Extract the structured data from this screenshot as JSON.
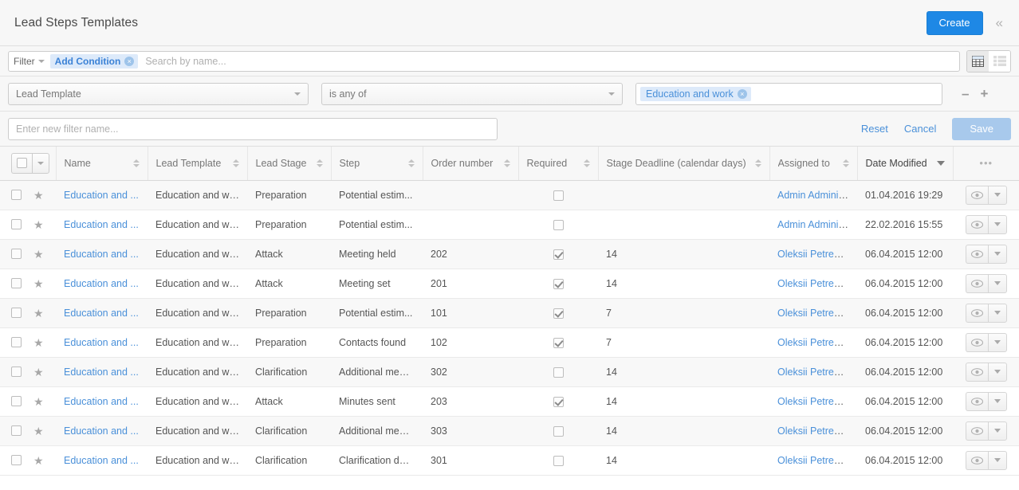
{
  "header": {
    "title": "Lead Steps Templates",
    "create_label": "Create",
    "collapse_icon": "chevron-double-left-icon"
  },
  "searchbar": {
    "filter_label": "Filter",
    "condition_chip": "Add Condition",
    "chip_remove": "×",
    "search_placeholder": "Search by name...",
    "search_value": "",
    "view_table_icon": "grid-view-icon",
    "view_list_icon": "list-view-icon",
    "active_view": "table"
  },
  "condition": {
    "field": "Lead Template",
    "operator": "is any of",
    "value_tag": "Education and work",
    "tag_remove": "×",
    "remove_condition_icon": "minus-icon",
    "add_condition_icon": "plus-icon"
  },
  "save_filter": {
    "name_placeholder": "Enter new filter name...",
    "name_value": "",
    "reset_label": "Reset",
    "cancel_label": "Cancel",
    "save_label": "Save"
  },
  "table": {
    "columns": [
      {
        "key": "name",
        "label": "Name",
        "sortable": true
      },
      {
        "key": "lead_template",
        "label": "Lead Template",
        "sortable": true
      },
      {
        "key": "lead_stage",
        "label": "Lead Stage",
        "sortable": true
      },
      {
        "key": "step",
        "label": "Step",
        "sortable": true
      },
      {
        "key": "order_number",
        "label": "Order number",
        "sortable": true
      },
      {
        "key": "required",
        "label": "Required",
        "sortable": true
      },
      {
        "key": "stage_deadline",
        "label": "Stage Deadline (calendar days)",
        "sortable": true
      },
      {
        "key": "assigned_to",
        "label": "Assigned to",
        "sortable": true
      },
      {
        "key": "date_modified",
        "label": "Date Modified",
        "sortable": true,
        "sorted": "desc"
      }
    ],
    "more_menu": "•••",
    "row_action_view_icon": "eye-icon",
    "rows": [
      {
        "name": "Education and ...",
        "lead_template": "Education and work",
        "lead_stage": "Preparation",
        "step": "Potential estim...",
        "order_number": "",
        "required": false,
        "stage_deadline": "",
        "assigned_to": "Admin Administ...",
        "date_modified": "01.04.2016 19:29"
      },
      {
        "name": "Education and ...",
        "lead_template": "Education and work",
        "lead_stage": "Preparation",
        "step": "Potential estim...",
        "order_number": "",
        "required": false,
        "stage_deadline": "",
        "assigned_to": "Admin Administ...",
        "date_modified": "22.02.2016 15:55"
      },
      {
        "name": "Education and ...",
        "lead_template": "Education and work",
        "lead_stage": "Attack",
        "step": "Meeting held",
        "order_number": "202",
        "required": true,
        "stage_deadline": "14",
        "assigned_to": "Oleksii Petrenko",
        "date_modified": "06.04.2015 12:00"
      },
      {
        "name": "Education and ...",
        "lead_template": "Education and work",
        "lead_stage": "Attack",
        "step": "Meeting set",
        "order_number": "201",
        "required": true,
        "stage_deadline": "14",
        "assigned_to": "Oleksii Petrenko",
        "date_modified": "06.04.2015 12:00"
      },
      {
        "name": "Education and ...",
        "lead_template": "Education and work",
        "lead_stage": "Preparation",
        "step": "Potential estim...",
        "order_number": "101",
        "required": true,
        "stage_deadline": "7",
        "assigned_to": "Oleksii Petrenko",
        "date_modified": "06.04.2015 12:00"
      },
      {
        "name": "Education and ...",
        "lead_template": "Education and work",
        "lead_stage": "Preparation",
        "step": "Contacts found",
        "order_number": "102",
        "required": true,
        "stage_deadline": "7",
        "assigned_to": "Oleksii Petrenko",
        "date_modified": "06.04.2015 12:00"
      },
      {
        "name": "Education and ...",
        "lead_template": "Education and work",
        "lead_stage": "Clarification",
        "step": "Additional meet...",
        "order_number": "302",
        "required": false,
        "stage_deadline": "14",
        "assigned_to": "Oleksii Petrenko",
        "date_modified": "06.04.2015 12:00"
      },
      {
        "name": "Education and ...",
        "lead_template": "Education and work",
        "lead_stage": "Attack",
        "step": "Minutes sent",
        "order_number": "203",
        "required": true,
        "stage_deadline": "14",
        "assigned_to": "Oleksii Petrenko",
        "date_modified": "06.04.2015 12:00"
      },
      {
        "name": "Education and ...",
        "lead_template": "Education and work",
        "lead_stage": "Clarification",
        "step": "Additional meet...",
        "order_number": "303",
        "required": false,
        "stage_deadline": "14",
        "assigned_to": "Oleksii Petrenko",
        "date_modified": "06.04.2015 12:00"
      },
      {
        "name": "Education and ...",
        "lead_template": "Education and work",
        "lead_stage": "Clarification",
        "step": "Clarification done",
        "order_number": "301",
        "required": false,
        "stage_deadline": "14",
        "assigned_to": "Oleksii Petrenko",
        "date_modified": "06.04.2015 12:00"
      }
    ]
  },
  "colors": {
    "accent": "#1e88e5",
    "link": "#4a90d9",
    "chip_bg": "#ddeafa",
    "header_bg": "#f7f7f7",
    "row_stripe": "#f8f8f8"
  }
}
